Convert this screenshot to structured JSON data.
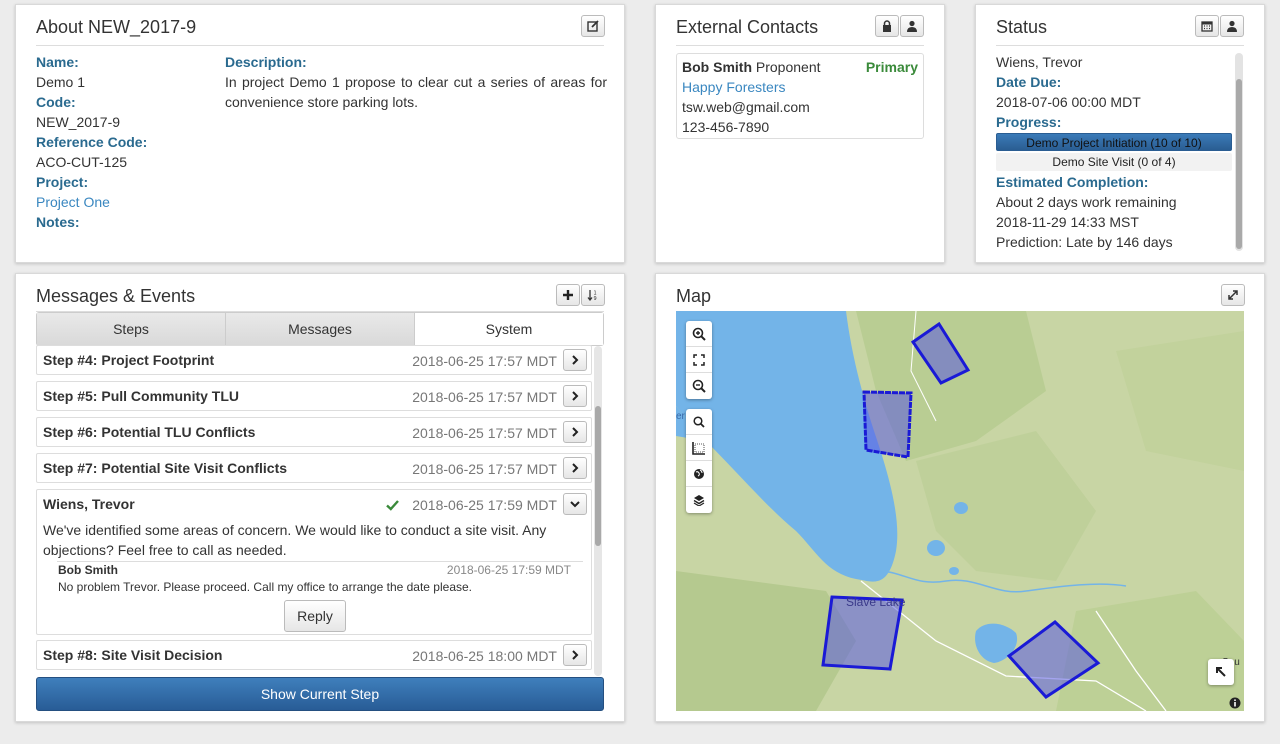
{
  "about": {
    "title": "About NEW_2017-9",
    "name_label": "Name:",
    "name": "Demo 1",
    "code_label": "Code:",
    "code": "NEW_2017-9",
    "ref_label": "Reference Code:",
    "ref": "ACO-CUT-125",
    "project_label": "Project:",
    "project": "Project One",
    "notes_label": "Notes:",
    "desc_label": "Description:",
    "desc": "In project Demo 1 propose to clear cut a series of areas for convenience store parking lots."
  },
  "contacts": {
    "title": "External Contacts",
    "name": "Bob Smith",
    "role": "Proponent",
    "primary": "Primary",
    "org": "Happy Foresters",
    "email": "tsw.web@gmail.com",
    "phone": "123-456-7890"
  },
  "status": {
    "title": "Status",
    "assignee": "Wiens, Trevor",
    "due_label": "Date Due:",
    "due": "2018-07-06 00:00 MDT",
    "progress_label": "Progress:",
    "progress": [
      {
        "label": "Demo Project Initiation (10 of 10)",
        "fraction": 1.0
      },
      {
        "label": "Demo Site Visit (0 of 4)",
        "fraction": 0.0
      }
    ],
    "est_label": "Estimated Completion:",
    "est_work": "About 2 days work remaining",
    "est_date": "2018-11-29 14:33 MST",
    "prediction": "Prediction: Late by 146 days"
  },
  "messages": {
    "title": "Messages & Events",
    "tabs": [
      "Steps",
      "Messages",
      "System"
    ],
    "steps": [
      {
        "title": "Step #4: Project Footprint",
        "date": "2018-06-25 17:57 MDT"
      },
      {
        "title": "Step #5: Pull Community TLU",
        "date": "2018-06-25 17:57 MDT"
      },
      {
        "title": "Step #6: Potential TLU Conflicts",
        "date": "2018-06-25 17:57 MDT"
      },
      {
        "title": "Step #7: Potential Site Visit Conflicts",
        "date": "2018-06-25 17:57 MDT"
      }
    ],
    "expanded": {
      "author": "Wiens, Trevor",
      "date": "2018-06-25 17:59 MDT",
      "body": "We've identified some areas of concern. We would like to conduct a site visit. Any objections? Feel free to call as needed.",
      "reply_author": "Bob Smith",
      "reply_date": "2018-06-25 17:59 MDT",
      "reply_body": "No problem Trevor. Please proceed. Call my office to arrange the date please.",
      "reply_button": "Reply"
    },
    "step8": {
      "title": "Step #8: Site Visit Decision",
      "date": "2018-06-25 18:00 MDT"
    },
    "show_current": "Show Current Step"
  },
  "map": {
    "title": "Map",
    "place_label": "Slave Lake",
    "edge_label_right": "Sou",
    "edge_label_left": "er"
  },
  "colors": {
    "label_blue": "#2a6a8f",
    "link_blue": "#3a87c0",
    "primary_green": "#3a8a3a",
    "button_blue": "#2f6ca8",
    "polygon_blue": "#1a1ad6"
  }
}
